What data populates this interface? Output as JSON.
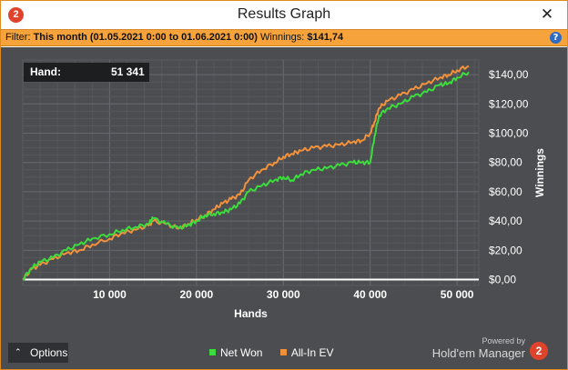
{
  "window": {
    "title": "Results Graph",
    "app_icon": "2",
    "close_label": "✕"
  },
  "filter": {
    "prefix": "Filter:",
    "range": "This month (01.05.2021 0:00 to 01.06.2021 0:00)",
    "winnings_label": "Winnings:",
    "winnings_value": "$141,74",
    "help_label": "?"
  },
  "hand_box": {
    "label": "Hand:",
    "value": "51 341"
  },
  "options": {
    "chevron": "⌃",
    "label": "Options"
  },
  "legend": {
    "net_won": "Net Won",
    "all_in_ev": "All-In EV"
  },
  "branding": {
    "powered_by": "Powered by",
    "product": "Hold'em Manager",
    "logo": "2"
  },
  "colors": {
    "net_won": "#3ddc3d",
    "all_in_ev": "#f2913b",
    "zero_line": "#ffffff",
    "plot_bg": "#4b4d51",
    "grid": "#5f6166",
    "accent": "#f7a33b"
  },
  "chart_data": {
    "type": "line",
    "xlabel": "Hands",
    "ylabel": "Winnings",
    "xlim": [
      0,
      52500
    ],
    "ylim": [
      -4,
      150
    ],
    "x_ticks": [
      10000,
      20000,
      30000,
      40000,
      50000
    ],
    "x_tick_labels": [
      "10 000",
      "20 000",
      "30 000",
      "40 000",
      "50 000"
    ],
    "y_ticks": [
      0,
      20,
      40,
      60,
      80,
      100,
      120,
      140
    ],
    "y_tick_labels": [
      "$0,00",
      "$20,00",
      "$40,00",
      "$60,00",
      "$80,00",
      "$100,00",
      "$120,00",
      "$140,00"
    ],
    "grid": true,
    "legend_position": "bottom",
    "series": [
      {
        "name": "Net Won",
        "color": "#3ddc3d",
        "x": [
          0,
          1000,
          2000,
          3500,
          5000,
          6500,
          8000,
          10000,
          11500,
          13000,
          14500,
          15000,
          16500,
          18000,
          19000,
          20000,
          21000,
          22000,
          23000,
          24000,
          25000,
          26000,
          27500,
          29000,
          30000,
          31000,
          32000,
          33500,
          35000,
          36500,
          38000,
          39000,
          40000,
          40500,
          41000,
          42000,
          43500,
          45000,
          46500,
          48000,
          49000,
          50000,
          51341
        ],
        "y": [
          0,
          8,
          12,
          15,
          20,
          24,
          28,
          31,
          34,
          36,
          38,
          42,
          38,
          35,
          37,
          40,
          44,
          45,
          46,
          48,
          52,
          60,
          64,
          68,
          70,
          68,
          72,
          75,
          76,
          78,
          80,
          80,
          80,
          98,
          112,
          117,
          120,
          125,
          128,
          133,
          134,
          138,
          141.74
        ]
      },
      {
        "name": "All-In EV",
        "color": "#f2913b",
        "x": [
          0,
          1000,
          2000,
          3500,
          5000,
          6500,
          8000,
          10000,
          11500,
          13000,
          14500,
          15000,
          16500,
          18000,
          19000,
          20000,
          21000,
          22000,
          23000,
          24000,
          25000,
          26000,
          27500,
          29000,
          30000,
          31000,
          32000,
          33500,
          35000,
          36500,
          38000,
          39000,
          40000,
          40500,
          41000,
          42000,
          43500,
          45000,
          46500,
          48000,
          49000,
          50000,
          51341
        ],
        "y": [
          0,
          7,
          10,
          14,
          18,
          20,
          24,
          28,
          32,
          34,
          37,
          40,
          38,
          35,
          38,
          41,
          44,
          48,
          52,
          55,
          58,
          68,
          75,
          80,
          84,
          86,
          88,
          90,
          91,
          92,
          94,
          95,
          100,
          108,
          117,
          122,
          126,
          130,
          134,
          138,
          140,
          143,
          146
        ]
      }
    ]
  }
}
